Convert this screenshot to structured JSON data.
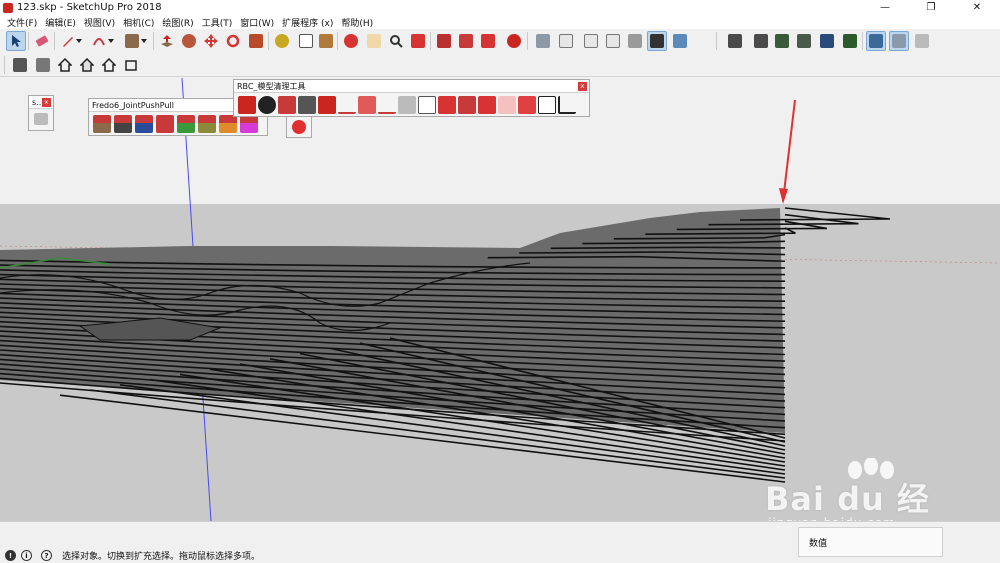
{
  "window": {
    "title": "123.skp - SketchUp Pro 2018",
    "minimize": "—",
    "maximize": "❐",
    "close": "✕"
  },
  "menu": [
    "文件(F)",
    "编辑(E)",
    "视图(V)",
    "相机(C)",
    "绘图(R)",
    "工具(T)",
    "窗口(W)",
    "扩展程序 (x)",
    "帮助(H)"
  ],
  "toolbar": {
    "active_tools": [
      "select",
      "top-view"
    ],
    "icon_colors": {
      "select": "#1e3f73",
      "eraser": "#d9587a",
      "pencil": "#c83a3a",
      "arc": "#c83a3a",
      "shape": "#8a6a4a",
      "pushpull": "#c8261f",
      "move": "#d23a3a",
      "rotate": "#d83333",
      "scale": "#b84a2a"
    }
  },
  "panels": {
    "small": {
      "title": "s..."
    },
    "fredo": {
      "title": "Fredo6_JointPushPull"
    },
    "rbc": {
      "title": "RBC_模型清理工具"
    },
    "close_glyph": "x"
  },
  "status": {
    "message": "选择对象。切换到扩充选择。拖动鼠标选择多项。",
    "measurement_label": "数值",
    "icons": [
      "info-icon",
      "credit-icon",
      "help-icon"
    ]
  },
  "watermark": {
    "main": "Bai du 经验",
    "sub": "jingyan.baidu.com"
  },
  "scene": {
    "sky_color": "#f0f0f0",
    "ground_color": "#c9c9c9",
    "terrain_color": "#6b6b6b",
    "annotation_arrow_color": "#e03030"
  }
}
